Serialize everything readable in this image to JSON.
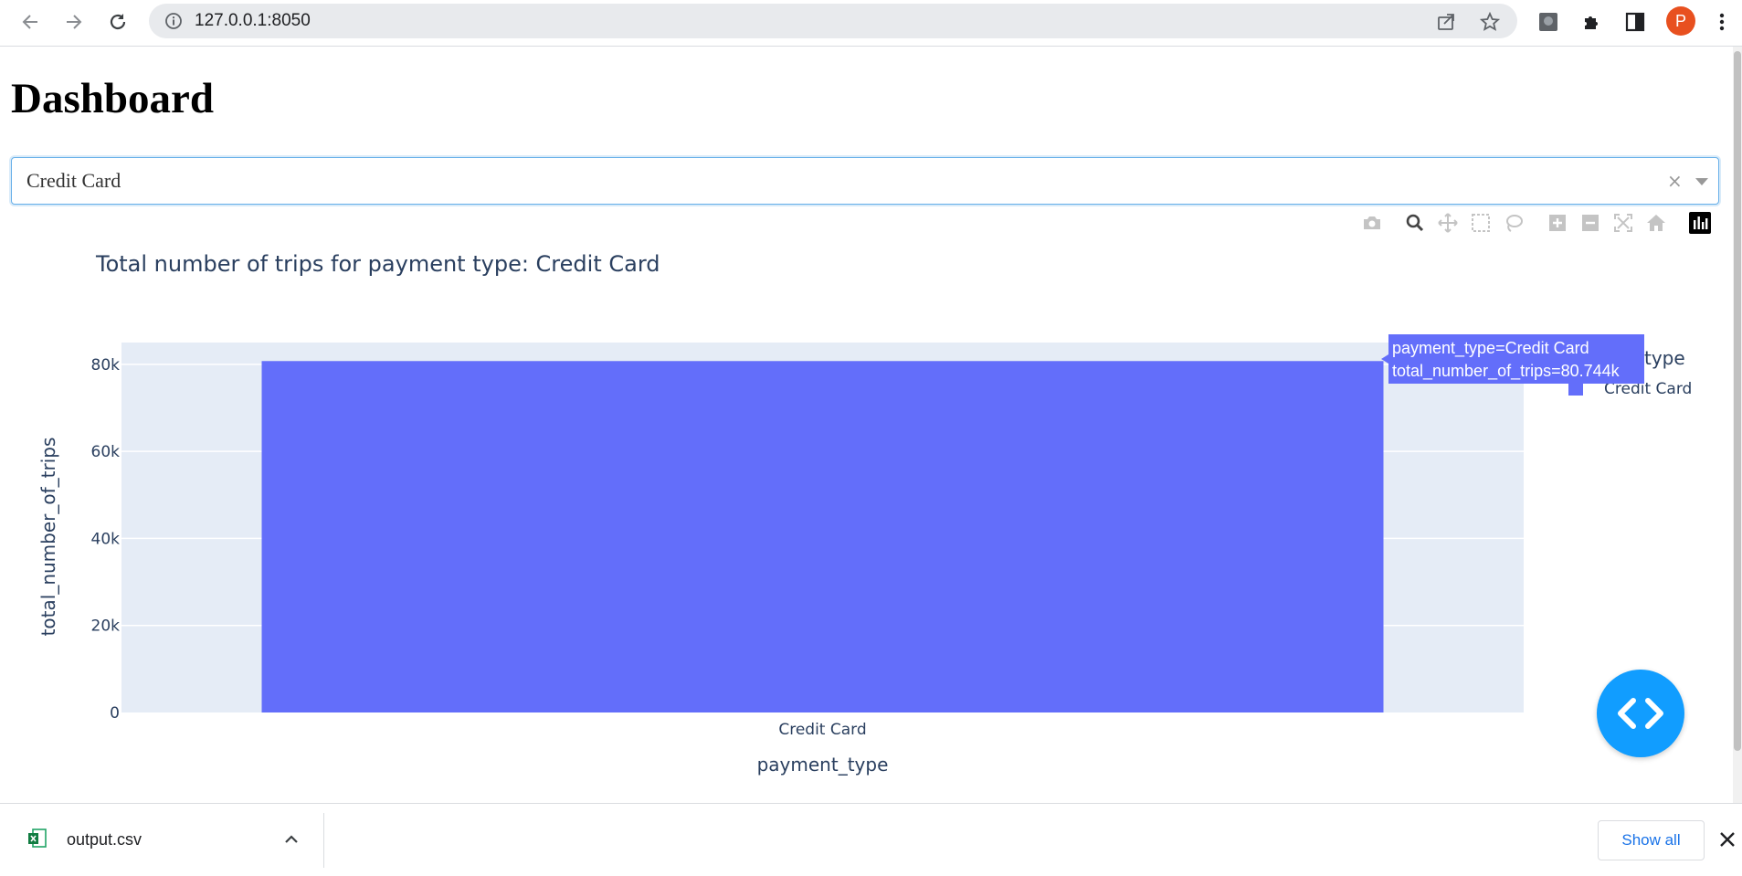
{
  "browser": {
    "url": "127.0.0.1:8050",
    "profile_initial": "P",
    "icons": [
      "back-arrow-icon",
      "forward-arrow-icon",
      "reload-icon",
      "info-icon",
      "share-icon",
      "bookmark-star-icon",
      "extension-icon",
      "puzzle-icon",
      "side-panel-icon",
      "kebab-menu-icon"
    ]
  },
  "page": {
    "heading": "Dashboard"
  },
  "dropdown": {
    "value": "Credit Card"
  },
  "modebar": {
    "buttons": [
      "camera-icon",
      "zoom-icon",
      "pan-icon",
      "box-select-icon",
      "lasso-select-icon",
      "zoom-in-icon",
      "zoom-out-icon",
      "autoscale-icon",
      "reset-axes-icon",
      "plotly-logo-icon"
    ]
  },
  "chart_data": {
    "type": "bar",
    "title": "Total number of trips for payment type: Credit Card",
    "xlabel": "payment_type",
    "ylabel": "total_number_of_trips",
    "categories": [
      "Credit Card"
    ],
    "series": [
      {
        "name": "Credit Card",
        "values": [
          80744
        ],
        "color": "#636efa"
      }
    ],
    "ylim": [
      0,
      85000
    ],
    "yticks": [
      0,
      20000,
      40000,
      60000,
      80000
    ],
    "ytick_labels": [
      "0",
      "20k",
      "40k",
      "60k",
      "80k"
    ],
    "legend_title_visible": "type",
    "legend_entry": "Credit Card",
    "plot_bg": "#e5ecf6",
    "tooltip": {
      "line1": "payment_type=Credit Card",
      "line2": "total_number_of_trips=80.744k"
    }
  },
  "download_bar": {
    "file_name": "output.csv",
    "show_all_label": "Show all"
  }
}
